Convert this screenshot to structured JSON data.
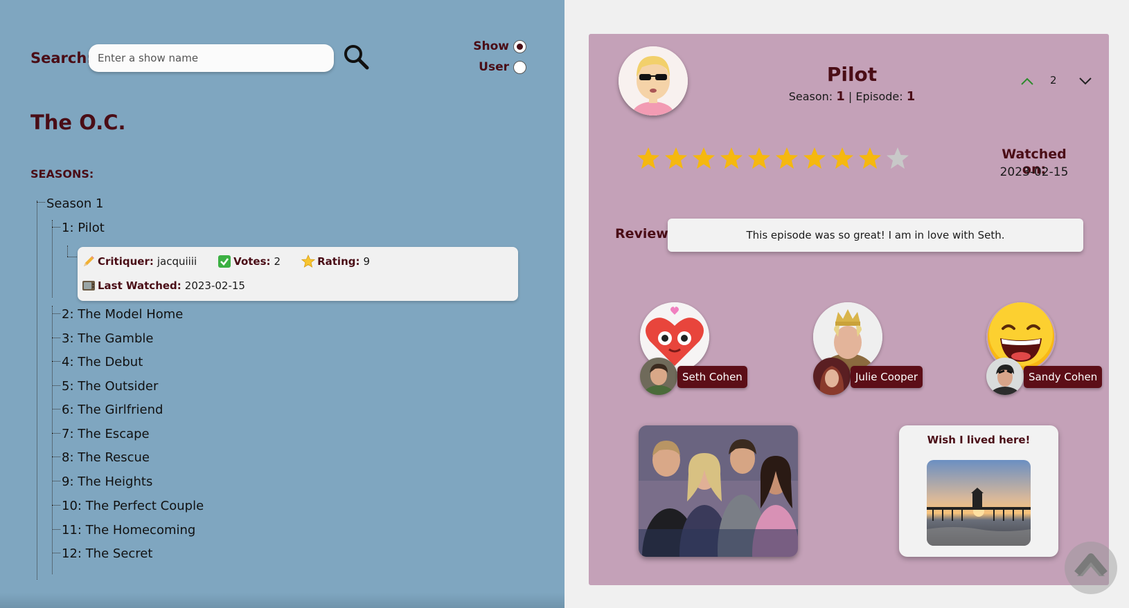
{
  "search": {
    "label": "Search:",
    "placeholder": "Enter a show name",
    "value": "",
    "mode_options": [
      {
        "label": "Show",
        "selected": true
      },
      {
        "label": "User",
        "selected": false
      }
    ]
  },
  "show": {
    "title": "The O.C.",
    "seasons_label": "SEASONS:",
    "season_name": "Season 1",
    "episodes": [
      "1: Pilot",
      "2: The Model Home",
      "3: The Gamble",
      "4: The Debut",
      "5: The Outsider",
      "6: The Girlfriend",
      "7: The Escape",
      "8: The Rescue",
      "9: The Heights",
      "10: The Perfect Couple",
      "11: The Homecoming",
      "12: The Secret"
    ],
    "critique": {
      "critiquer_label": "Critiquer:",
      "critiquer": "jacquiiii",
      "votes_label": "Votes:",
      "votes": "2",
      "rating_label": "Rating:",
      "rating": "9",
      "last_watched_label": "Last Watched:",
      "last_watched": "2023-02-15"
    }
  },
  "review_card": {
    "episode_title": "Pilot",
    "season_label": "Season:",
    "season": "1",
    "separator": "|",
    "episode_label": "Episode:",
    "episode": "1",
    "vote_count": "2",
    "rating": 9,
    "rating_max": 10,
    "watched_label": "Watched on:",
    "watched_date": "2023-02-15",
    "review_label": "Review:",
    "review_text": "This episode was so great! I am in love with Seth.",
    "reactions": [
      {
        "character": "Seth Cohen",
        "reaction_icon": "heart-eyes-icon"
      },
      {
        "character": "Julie Cooper",
        "reaction_icon": "king-icon"
      },
      {
        "character": "Sandy Cohen",
        "reaction_icon": "laughing-icon"
      }
    ],
    "note_title": "Wish I lived here!"
  },
  "colors": {
    "left_bg": "#7fa6c0",
    "card_bg": "#c4a1b8",
    "accent": "#4a0d16",
    "star_on": "#f5b80f",
    "star_off": "#c8c8c8"
  }
}
